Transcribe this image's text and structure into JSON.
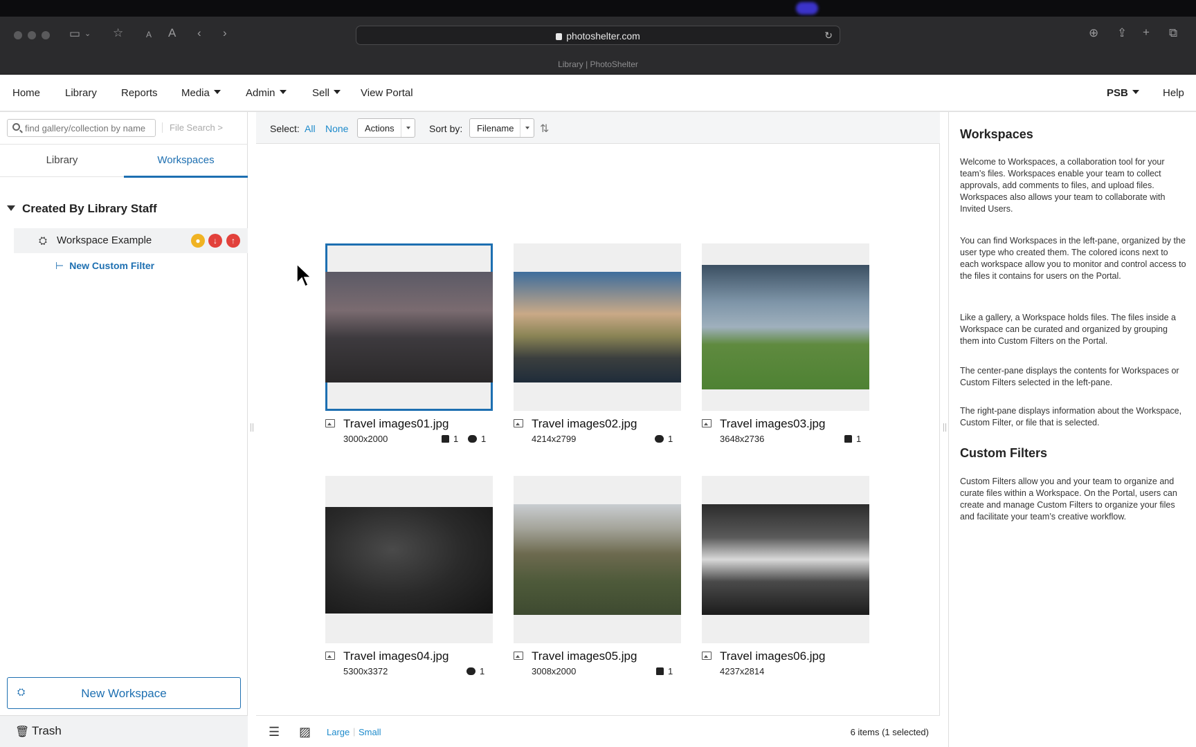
{
  "browser": {
    "url": "photoshelter.com",
    "tab_title": "Library | PhotoShelter"
  },
  "nav": {
    "items": [
      "Home",
      "Library",
      "Reports",
      "Media",
      "Admin",
      "Sell",
      "View Portal"
    ],
    "account": "PSB",
    "help": "Help"
  },
  "left": {
    "search_placeholder": "find gallery/collection by name",
    "file_search": "File Search >",
    "tabs": [
      "Library",
      "Workspaces"
    ],
    "active_tab": "Workspaces",
    "group_title": "Created By Library Staff",
    "workspace_name": "Workspace Example",
    "custom_filter": "New Custom Filter",
    "new_workspace": "New Workspace",
    "trash": "Trash",
    "status_colors": {
      "view": "#f0b323",
      "download": "#e2413b",
      "upload": "#e2413b"
    }
  },
  "toolbar": {
    "select_label": "Select:",
    "all": "All",
    "none": "None",
    "actions": "Actions",
    "sort_label": "Sort by:",
    "sort_value": "Filename"
  },
  "files": [
    {
      "name": "Travel images01.jpg",
      "dims": "3000x2000",
      "likes": "1",
      "comments": "1",
      "selected": true
    },
    {
      "name": "Travel images02.jpg",
      "dims": "4214x2799",
      "likes": "",
      "comments": "1",
      "selected": false
    },
    {
      "name": "Travel images03.jpg",
      "dims": "3648x2736",
      "likes": "1",
      "comments": "",
      "selected": false
    },
    {
      "name": "Travel images04.jpg",
      "dims": "5300x3372",
      "likes": "",
      "comments": "1",
      "selected": false
    },
    {
      "name": "Travel images05.jpg",
      "dims": "3008x2000",
      "likes": "1",
      "comments": "",
      "selected": false
    },
    {
      "name": "Travel images06.jpg",
      "dims": "4237x2814",
      "likes": "",
      "comments": "",
      "selected": false
    }
  ],
  "bottom": {
    "large": "Large",
    "small": "Small",
    "count": "6 items  (1 selected)"
  },
  "right": {
    "title1": "Workspaces",
    "p1": "Welcome to Workspaces, a collaboration tool for your team’s files. Workspaces enable your team to collect approvals, add comments to files, and upload files. Workspaces also allows your team to collaborate with Invited Users.",
    "p2": "You can find Workspaces in the left-pane, organized by the user type who created them. The colored icons next to each workspace allow you to monitor and control access to the files it contains for users on the Portal.",
    "p3": "Like a gallery, a Workspace holds files. The files inside a Workspace can be curated and organized by grouping them into Custom Filters on the Portal.",
    "p4": "The center-pane displays the contents for Workspaces or Custom Filters selected in the left-pane.",
    "p5": "The right-pane displays information about the Workspace, Custom Filter, or file that is selected.",
    "title2": "Custom Filters",
    "p6": "Custom Filters allow you and your team to organize and curate files within a Workspace. On the Portal, users can create and manage Custom Filters to organize your files and facilitate your team’s creative workflow."
  },
  "accent_color": "#1d6fb1"
}
